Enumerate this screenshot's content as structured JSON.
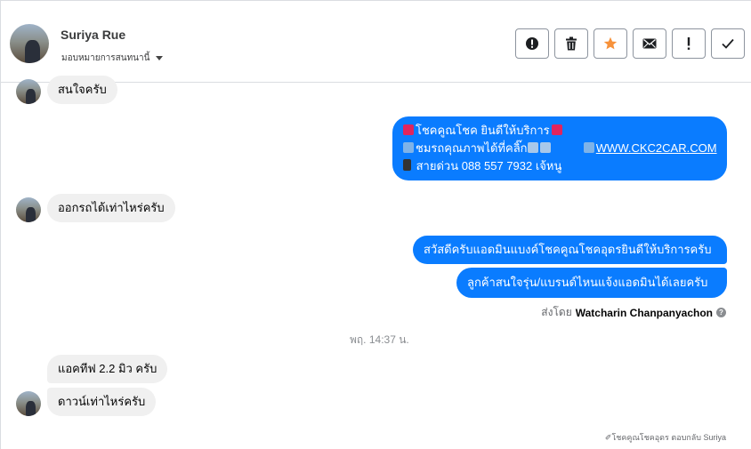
{
  "contact": {
    "name": "Suriya Rue",
    "assign_label": "มอบหมายการสนทนานี้"
  },
  "toolbar": {
    "buttons": [
      {
        "name": "spam-button",
        "icon": "alert-circle-icon"
      },
      {
        "name": "delete-button",
        "icon": "trash-icon"
      },
      {
        "name": "star-button",
        "icon": "star-icon"
      },
      {
        "name": "mark-unread-button",
        "icon": "envelope-icon"
      },
      {
        "name": "follow-up-button",
        "icon": "exclamation-icon"
      },
      {
        "name": "done-button",
        "icon": "check-icon"
      }
    ],
    "star_color": "#f7923b"
  },
  "messages": {
    "m1": "สนใจครับ",
    "m2_line1": "โชคคูณโชค ยินดีให้บริการ",
    "m2_line2a": "ชมรถคุณภาพได้ที่คลิ๊ก",
    "m2_link": "WWW.CKC2CAR.COM",
    "m2_line3": "สายด่วน 088 557 7932 เจ้หนู",
    "m3": "ออกรถได้เท่าไหร่ครับ",
    "m4": "สวัสดีครับแอดมินแบงค์โชคคูณโชคอุดรยินดีให้บริการครับ",
    "m5": "ลูกค้าสนใจรุ่น/แบรนด์ไหนแจ้งแอดมินได้เลยครับ",
    "m6": "แอคทีฟ 2.2 มิว ครับ",
    "m7": "ดาวน์เท่าไหร่ครับ"
  },
  "sent_by": {
    "prefix": "ส่งโดย",
    "name": "Watcharin Chanpanyachon",
    "help": "?"
  },
  "timestamp": "พฤ. 14:37 น.",
  "footer": "✐โชคคูณโชคอุดร ตอบกลับ Suriya",
  "colors": {
    "outgoing": "#0a7cff",
    "incoming": "#f0f0f0"
  }
}
